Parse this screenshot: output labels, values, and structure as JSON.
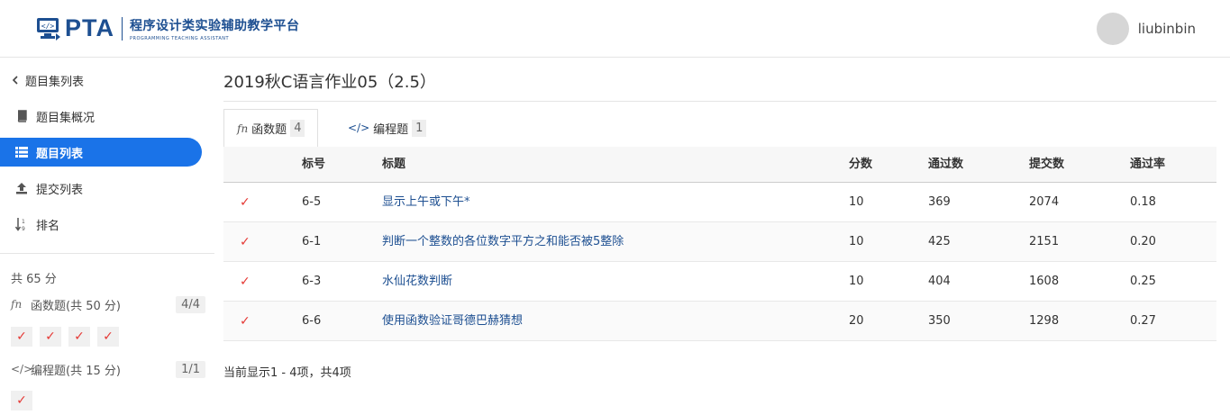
{
  "header": {
    "brand": "PTA",
    "brand_cn": "程序设计类实验辅助教学平台",
    "brand_en": "PROGRAMMING TEACHING ASSISTANT",
    "username": "liubinbin"
  },
  "sidebar": {
    "back_label": "题目集列表",
    "items": [
      {
        "label": "题目集概况",
        "icon": "book-icon"
      },
      {
        "label": "题目列表",
        "icon": "list-icon"
      },
      {
        "label": "提交列表",
        "icon": "upload-icon"
      },
      {
        "label": "排名",
        "icon": "sort-icon"
      }
    ],
    "total": "共 65 分",
    "categories": [
      {
        "label": "函数题(共 50 分)",
        "count": "4/4",
        "icon": "function-icon"
      },
      {
        "label": "编程题(共 15 分)",
        "count": "1/1",
        "icon": "code-icon"
      }
    ]
  },
  "main": {
    "title": "2019秋C语言作业05（2.5）",
    "tabs": [
      {
        "label": "函数题",
        "count": "4",
        "icon": "function-icon"
      },
      {
        "label": "编程题",
        "count": "1",
        "icon": "code-icon"
      }
    ],
    "table": {
      "headers": [
        "标号",
        "标题",
        "分数",
        "通过数",
        "提交数",
        "通过率"
      ],
      "rows": [
        {
          "status": "✓",
          "id": "6-5",
          "title": "显示上午或下午*",
          "score": "10",
          "passed": "369",
          "submitted": "2074",
          "rate": "0.18"
        },
        {
          "status": "✓",
          "id": "6-1",
          "title": "判断一个整数的各位数字平方之和能否被5整除",
          "score": "10",
          "passed": "425",
          "submitted": "2151",
          "rate": "0.20"
        },
        {
          "status": "✓",
          "id": "6-3",
          "title": "水仙花数判断",
          "score": "10",
          "passed": "404",
          "submitted": "1608",
          "rate": "0.25"
        },
        {
          "status": "✓",
          "id": "6-6",
          "title": "使用函数验证哥德巴赫猜想",
          "score": "20",
          "passed": "350",
          "submitted": "1298",
          "rate": "0.27"
        }
      ]
    },
    "summary": "当前显示1 - 4项，共4项"
  },
  "colors": {
    "accent": "#1a73e8",
    "brand": "#1d4f91",
    "check": "#e53935"
  }
}
